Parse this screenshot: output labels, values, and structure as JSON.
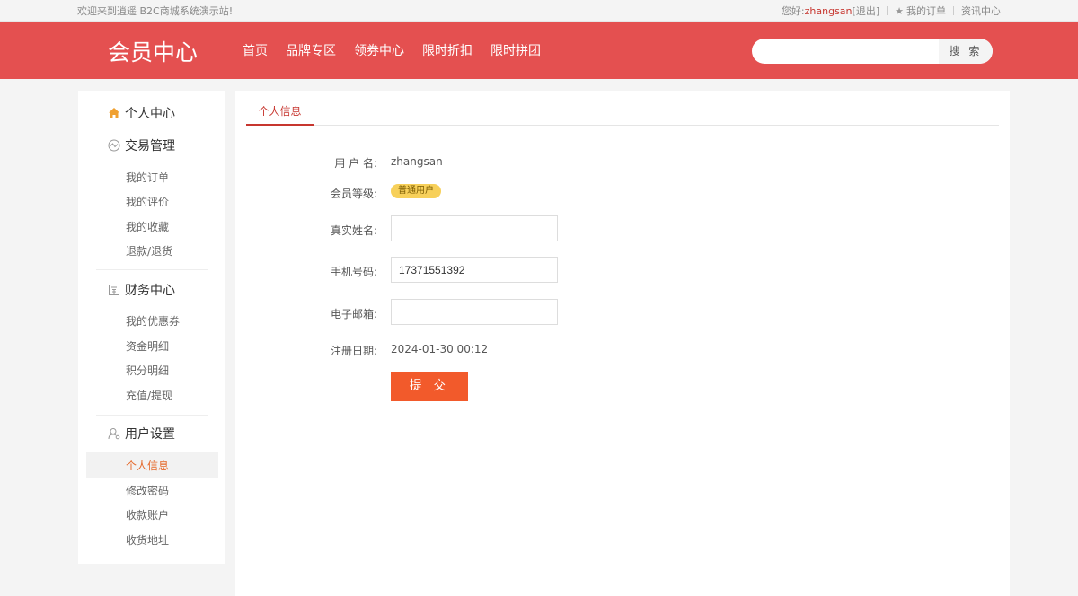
{
  "topbar": {
    "welcome": "欢迎来到逍遥 B2C商城系统演示站!",
    "greeting": "您好:",
    "username": "zhangsan",
    "logout": "[退出]",
    "my_orders": "我的订单",
    "news_center": "资讯中心"
  },
  "header": {
    "logo": "会员中心",
    "nav": [
      "首页",
      "品牌专区",
      "领券中心",
      "限时折扣",
      "限时拼团"
    ],
    "search_placeholder": "",
    "search_button": "搜 索"
  },
  "sidebar": {
    "sections": [
      {
        "title": "个人中心",
        "icon": "home-icon",
        "items": []
      },
      {
        "title": "交易管理",
        "icon": "trade-icon",
        "items": [
          "我的订单",
          "我的评价",
          "我的收藏",
          "退款/退货"
        ]
      },
      {
        "title": "财务中心",
        "icon": "finance-icon",
        "items": [
          "我的优惠券",
          "资金明细",
          "积分明细",
          "充值/提现"
        ]
      },
      {
        "title": "用户设置",
        "icon": "user-settings-icon",
        "items": [
          "个人信息",
          "修改密码",
          "收款账户",
          "收货地址"
        ]
      }
    ],
    "active_item": "个人信息"
  },
  "main": {
    "tab": "个人信息",
    "form": {
      "username_label": "用 户 名:",
      "username_value": "zhangsan",
      "level_label": "会员等级:",
      "level_value": "普通用户",
      "realname_label": "真实姓名:",
      "realname_value": "",
      "phone_label": "手机号码:",
      "phone_value": "17371551392",
      "email_label": "电子邮箱:",
      "email_value": "",
      "regdate_label": "注册日期:",
      "regdate_value": "2024-01-30 00:12",
      "submit": "提 交"
    }
  },
  "colors": {
    "header_bg": "#e45050",
    "accent": "#c7362f",
    "submit_bg": "#f25a2b",
    "badge_bg": "#f7d05a",
    "active_sub": "#e5692b"
  }
}
